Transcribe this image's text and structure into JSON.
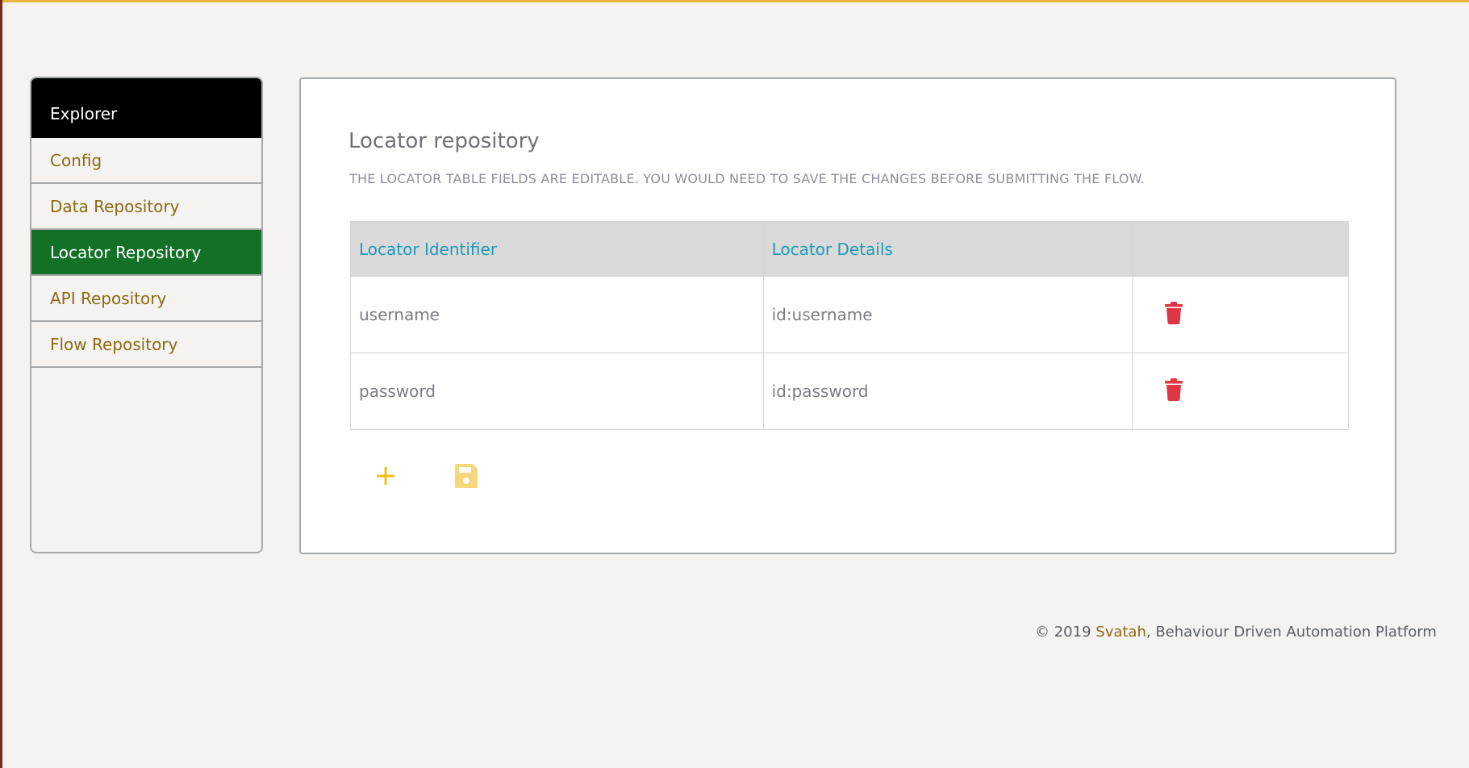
{
  "sidebar": {
    "header": "Explorer",
    "items": [
      {
        "label": "Config",
        "active": false
      },
      {
        "label": "Data Repository",
        "active": false
      },
      {
        "label": "Locator Repository",
        "active": true
      },
      {
        "label": "API Repository",
        "active": false
      },
      {
        "label": "Flow Repository",
        "active": false
      }
    ]
  },
  "main": {
    "title": "Locator repository",
    "note": "THE LOCATOR TABLE FIELDS ARE EDITABLE. YOU WOULD NEED TO SAVE THE CHANGES BEFORE SUBMITTING THE FLOW.",
    "table": {
      "headers": [
        "Locator Identifier",
        "Locator Details",
        ""
      ],
      "rows": [
        {
          "identifier": "username",
          "details": "id:username"
        },
        {
          "identifier": "password",
          "details": "id:password"
        }
      ]
    },
    "icons": {
      "delete": "trash-icon",
      "add": "plus-icon",
      "save": "floppy-disk-icon"
    }
  },
  "footer": {
    "prefix": "© 2019 ",
    "brand": "Svatah",
    "suffix": ", Behaviour Driven Automation Platform"
  },
  "colors": {
    "accent_gold": "#8a6a12",
    "active_green": "#127126",
    "header_blue": "#1f9ab8",
    "delete_red": "#e03544",
    "action_yellow": "#f2bd1c",
    "save_yellow_disabled": "#f6d77a",
    "top_border": "#e8b43a"
  }
}
